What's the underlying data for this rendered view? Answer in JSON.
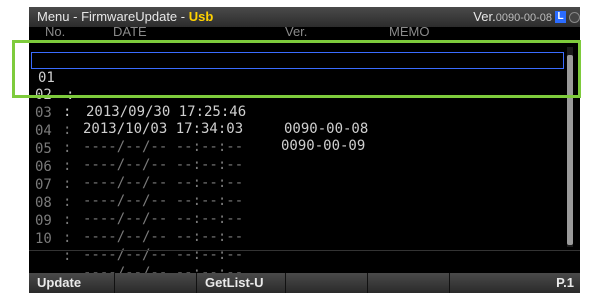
{
  "title": {
    "prefix": "Menu - FirmwareUpdate - ",
    "source": "Usb",
    "ver_label": "Ver.",
    "ver_value": "0090-00-08",
    "badge": "L"
  },
  "columns": {
    "no": "No.",
    "date": "DATE",
    "ver": "Ver.",
    "memo": "MEMO"
  },
  "rows": [
    {
      "no": "01",
      "sep": ":",
      "date": "2013/09/30 17:25:46",
      "ver": "0090-00-08"
    },
    {
      "no": "02",
      "sep": ":",
      "date": "2013/10/03 17:34:03",
      "ver": "0090-00-09"
    },
    {
      "no": "03",
      "sep": ":",
      "date": "----/--/-- --:--:--",
      "ver": ""
    },
    {
      "no": "04",
      "sep": ":",
      "date": "----/--/-- --:--:--",
      "ver": ""
    },
    {
      "no": "05",
      "sep": ":",
      "date": "----/--/-- --:--:--",
      "ver": ""
    },
    {
      "no": "06",
      "sep": ":",
      "date": "----/--/-- --:--:--",
      "ver": ""
    },
    {
      "no": "07",
      "sep": ":",
      "date": "----/--/-- --:--:--",
      "ver": ""
    },
    {
      "no": "08",
      "sep": ":",
      "date": "----/--/-- --:--:--",
      "ver": ""
    },
    {
      "no": "09",
      "sep": ":",
      "date": "----/--/-- --:--:--",
      "ver": ""
    },
    {
      "no": "10",
      "sep": ":",
      "date": "----/--/-- --:--:--",
      "ver": ""
    }
  ],
  "softkeys": {
    "f1": "Update",
    "f2": "",
    "f3": "GetList-U",
    "f4": "",
    "f5": "",
    "f6": "P.1"
  },
  "colors": {
    "accent": "#ffd200",
    "selection": "#3a6cff",
    "highlight": "#7ecb3c"
  }
}
